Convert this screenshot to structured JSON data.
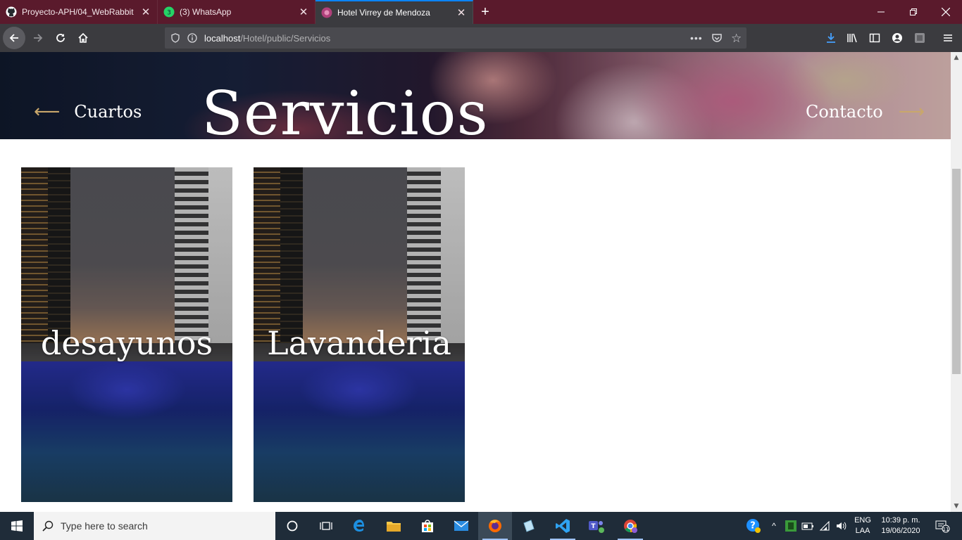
{
  "browser": {
    "tabs": [
      {
        "title": "Proyecto-APH/04_WebRabbit a",
        "icon": "github-icon",
        "active": false
      },
      {
        "title": "(3) WhatsApp",
        "icon": "whatsapp-icon",
        "badge": "3",
        "active": false
      },
      {
        "title": "Hotel Virrey de Mendoza",
        "icon": "site-icon",
        "active": true
      }
    ],
    "new_tab": "+",
    "url": {
      "host": "localhost",
      "path": "/Hotel/public/Servicios"
    },
    "colors": {
      "tab_strip": "#5a1a2c",
      "toolbar": "#3b3b3f",
      "accent": "#0a84ff"
    }
  },
  "hero": {
    "prev_label": "Cuartos",
    "title": "Servicios",
    "next_label": "Contacto",
    "arrow_color": "#c9a76b"
  },
  "services": [
    {
      "label": "desayunos"
    },
    {
      "label": "Lavanderia"
    }
  ],
  "taskbar": {
    "search_placeholder": "Type here to search",
    "lang_top": "ENG",
    "lang_bottom": "LAA",
    "time": "10:39 p. m.",
    "date": "19/06/2020",
    "notification_count": "11"
  }
}
